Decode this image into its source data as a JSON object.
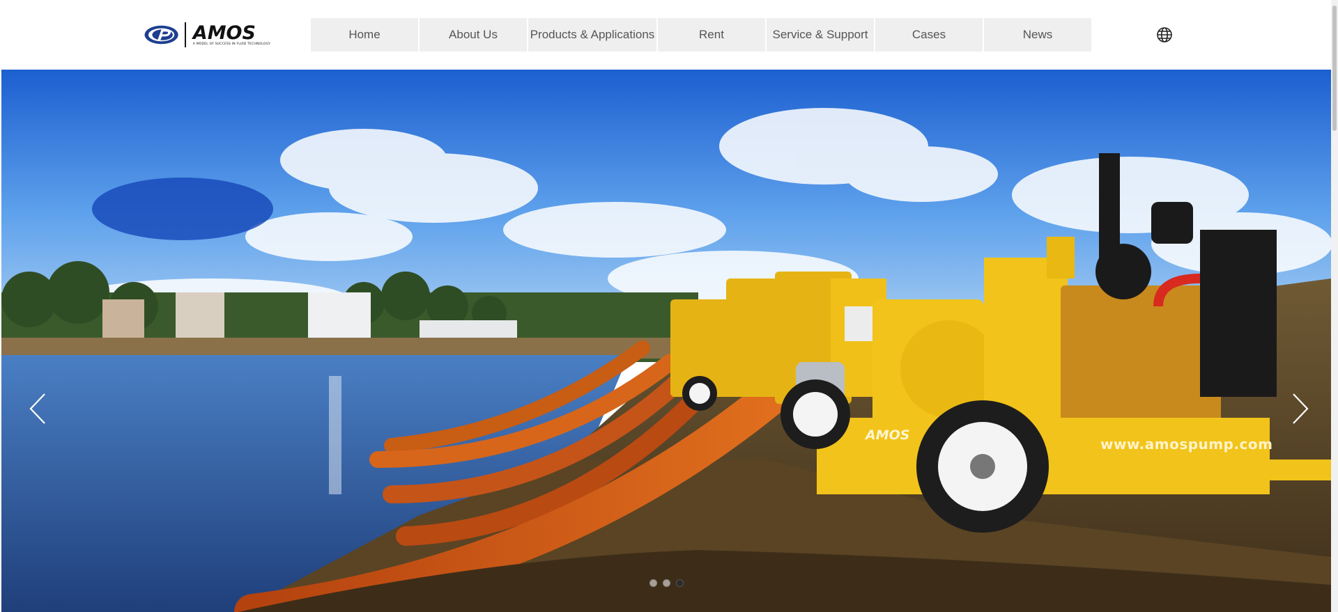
{
  "header": {
    "logo": {
      "name": "AMOS",
      "tagline": "A MODEL OF SUCCESS IN FLUID TECHNOLOGY"
    },
    "nav": [
      {
        "label": "Home"
      },
      {
        "label": "About Us"
      },
      {
        "label": "Products & Applications"
      },
      {
        "label": "Rent"
      },
      {
        "label": "Service & Support"
      },
      {
        "label": "Cases"
      },
      {
        "label": "News"
      }
    ],
    "language_icon": "globe-icon"
  },
  "hero": {
    "pump_brand": "AMOS",
    "pump_url": "www.amospump.com",
    "slide_count": 3,
    "active_slide": 3,
    "prev_icon": "chevron-left-icon",
    "next_icon": "chevron-right-icon"
  },
  "colors": {
    "nav_bg": "#efefef",
    "nav_text": "#555555",
    "logo_blue": "#1d3f8f",
    "pump_yellow": "#f2c31a",
    "hose_orange": "#c9521b"
  }
}
